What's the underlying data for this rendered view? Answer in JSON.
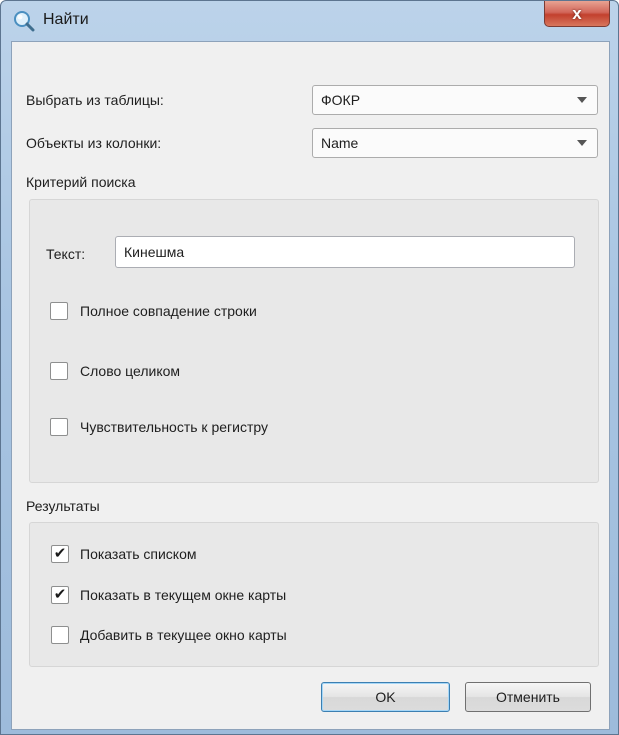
{
  "window": {
    "title": "Найти",
    "close_glyph": "x"
  },
  "icons": {
    "title_icon": "search-magnifier-icon",
    "close_icon": "close-icon",
    "dropdown_icon": "chevron-down-icon",
    "check_glyph": "✔"
  },
  "colors": {
    "title_bar": "#a9c5e2",
    "close_button": "#c2402e",
    "client_bg": "#f0f0f0",
    "group_bg": "#e8e8e8"
  },
  "form": {
    "table_label": "Выбрать из таблицы:",
    "table_value": "ФОКР",
    "column_label": "Объекты из колонки:",
    "column_value": "Name"
  },
  "search_criteria": {
    "section_label": "Критерий поиска",
    "text_label": "Текст:",
    "text_value": "Кинешма",
    "options": [
      {
        "label": "Полное совпадение строки",
        "checked": false
      },
      {
        "label": "Слово целиком",
        "checked": false
      },
      {
        "label": "Чувствительность к регистру",
        "checked": false
      }
    ]
  },
  "results": {
    "section_label": "Результаты",
    "options": [
      {
        "label": "Показать списком",
        "checked": true
      },
      {
        "label": "Показать в текущем окне карты",
        "checked": true
      },
      {
        "label": "Добавить в текущее окно карты",
        "checked": false
      }
    ]
  },
  "buttons": {
    "ok": "OK",
    "cancel": "Отменить"
  }
}
